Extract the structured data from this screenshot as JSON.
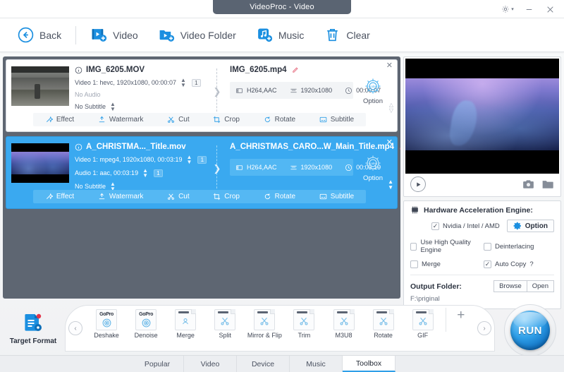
{
  "window": {
    "title": "VideoProc - Video",
    "controls": [
      {
        "name": "settings-gear",
        "glyph": "gear"
      },
      {
        "name": "minimize",
        "glyph": "minus"
      },
      {
        "name": "close",
        "glyph": "x"
      }
    ]
  },
  "toolbar": {
    "items": [
      {
        "id": "back",
        "label": "Back",
        "icon": "back-arrow-icon"
      },
      {
        "id": "video",
        "label": "Video",
        "icon": "add-video-icon"
      },
      {
        "id": "video-folder",
        "label": "Video Folder",
        "icon": "add-video-folder-icon"
      },
      {
        "id": "music",
        "label": "Music",
        "icon": "add-music-icon"
      },
      {
        "id": "clear",
        "label": "Clear",
        "icon": "trash-icon"
      }
    ]
  },
  "file_list": {
    "rows": [
      {
        "selected": false,
        "source_name": "IMG_6205.MOV",
        "video_line": "Video 1: hevc, 1920x1080, 00:00:07",
        "audio_line": "No Audio",
        "subtitle_line": "No Subtitle",
        "video_count": "1",
        "output_name": "IMG_6205.mp4",
        "codec": "H264,AAC",
        "resolution": "1920x1080",
        "duration": "00:00:07",
        "option_label": "Option",
        "option_badge": "codec",
        "actions": [
          {
            "id": "effect",
            "label": "Effect",
            "icon": "effect-wand-icon"
          },
          {
            "id": "watermark",
            "label": "Watermark",
            "icon": "watermark-icon"
          },
          {
            "id": "cut",
            "label": "Cut",
            "icon": "scissors-icon"
          },
          {
            "id": "crop",
            "label": "Crop",
            "icon": "crop-icon"
          },
          {
            "id": "rotate",
            "label": "Rotate",
            "icon": "rotate-icon"
          },
          {
            "id": "subtitle",
            "label": "Subtitle",
            "icon": "subtitle-icon"
          }
        ]
      },
      {
        "selected": true,
        "source_name": "A_CHRISTMA..._Title.mov",
        "video_line": "Video 1: mpeg4, 1920x1080, 00:03:19",
        "audio_line": "Audio 1: aac, 00:03:19",
        "subtitle_line": "No Subtitle",
        "video_count": "1",
        "audio_count": "1",
        "output_name": "A_CHRISTMAS_CARO...W_Main_Title.mp4",
        "codec": "H264,AAC",
        "resolution": "1920x1080",
        "duration": "00:03:19",
        "option_label": "Option",
        "option_badge": "codec",
        "actions": [
          {
            "id": "effect",
            "label": "Effect",
            "icon": "effect-wand-icon"
          },
          {
            "id": "watermark",
            "label": "Watermark",
            "icon": "watermark-icon"
          },
          {
            "id": "cut",
            "label": "Cut",
            "icon": "scissors-icon"
          },
          {
            "id": "crop",
            "label": "Crop",
            "icon": "crop-icon"
          },
          {
            "id": "rotate",
            "label": "Rotate",
            "icon": "rotate-icon"
          },
          {
            "id": "subtitle",
            "label": "Subtitle",
            "icon": "subtitle-icon"
          }
        ]
      }
    ]
  },
  "preview": {
    "play_label": "play-button",
    "snapshot_icon": "camera-icon",
    "folder_icon": "folder-icon"
  },
  "settings": {
    "hardware_title": "Hardware Acceleration Engine:",
    "hardware_icon": "chip-icon",
    "nvidia_label": "Nvidia / Intel / AMD",
    "nvidia_checked": true,
    "option_label": "Option",
    "checkboxes": [
      {
        "id": "high-quality-engine",
        "label": "Use High Quality Engine",
        "checked": false
      },
      {
        "id": "deinterlacing",
        "label": "Deinterlacing",
        "checked": false
      },
      {
        "id": "merge",
        "label": "Merge",
        "checked": false
      },
      {
        "id": "auto-copy",
        "label": "Auto Copy",
        "checked": true,
        "suffix": "?"
      }
    ],
    "output_folder_label": "Output Folder:",
    "browse_label": "Browse",
    "open_label": "Open",
    "output_path": "F:\\priginal"
  },
  "format_bar": {
    "target_format_label": "Target Format",
    "prev_label": "‹",
    "next_label": "›",
    "add_label": "+",
    "tools": [
      {
        "id": "deshake",
        "label": "Deshake",
        "icon": "gopro-deshake-icon",
        "badge": "GoPro"
      },
      {
        "id": "denoise",
        "label": "Denoise",
        "icon": "gopro-denoise-icon",
        "badge": "GoPro"
      },
      {
        "id": "merge",
        "label": "Merge",
        "icon": "merge-icon"
      },
      {
        "id": "split",
        "label": "Split",
        "icon": "split-icon"
      },
      {
        "id": "mirror-flip",
        "label": "Mirror & Flip",
        "icon": "mirror-flip-icon"
      },
      {
        "id": "trim",
        "label": "Trim",
        "icon": "trim-icon"
      },
      {
        "id": "m3u8",
        "label": "M3U8",
        "icon": "m3u8-icon"
      },
      {
        "id": "rotate",
        "label": "Rotate",
        "icon": "rotate-tool-icon"
      },
      {
        "id": "gif",
        "label": "GIF",
        "icon": "gif-icon"
      }
    ],
    "run_label": "RUN"
  },
  "tabs": [
    {
      "id": "popular",
      "label": "Popular",
      "active": false
    },
    {
      "id": "video",
      "label": "Video",
      "active": false
    },
    {
      "id": "device",
      "label": "Device",
      "active": false
    },
    {
      "id": "music",
      "label": "Music",
      "active": false
    },
    {
      "id": "toolbox",
      "label": "Toolbox",
      "active": true
    }
  ],
  "colors": {
    "accent": "#2f9fe8",
    "selected_row": "#3aa9f0",
    "list_bg": "#5e6672",
    "title_pill": "#5a6472"
  }
}
